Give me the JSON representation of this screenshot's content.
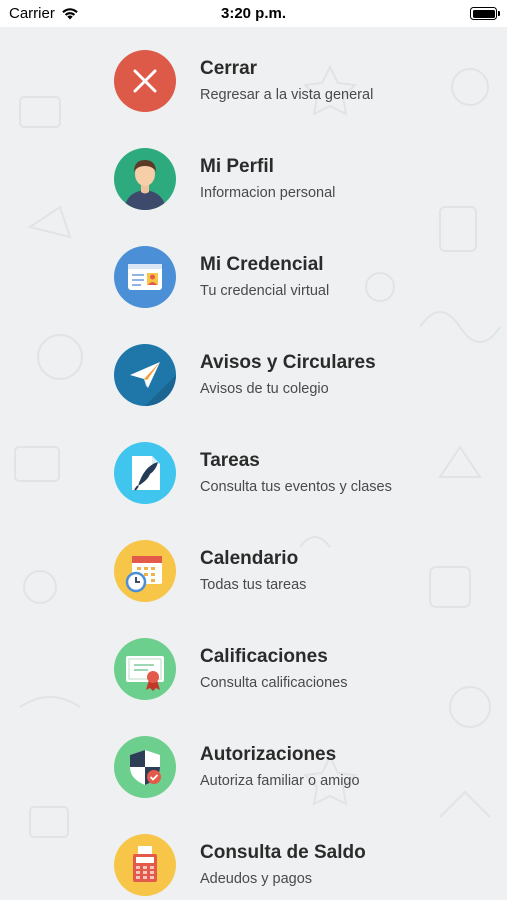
{
  "status_bar": {
    "carrier": "Carrier",
    "time": "3:20 p.m."
  },
  "menu": {
    "items": [
      {
        "title": "Cerrar",
        "subtitle": "Regresar a la vista general",
        "icon": "close-icon",
        "color": "#dc5a47"
      },
      {
        "title": "Mi Perfil",
        "subtitle": "Informacion personal",
        "icon": "user-avatar-icon",
        "color": "#2eab7e"
      },
      {
        "title": "Mi Credencial",
        "subtitle": "Tu credencial virtual",
        "icon": "id-card-icon",
        "color": "#4b8fd6"
      },
      {
        "title": "Avisos y Circulares",
        "subtitle": "Avisos de tu colegio",
        "icon": "paper-plane-icon",
        "color": "#1f77a9"
      },
      {
        "title": "Tareas",
        "subtitle": "Consulta tus eventos y clases",
        "icon": "quill-document-icon",
        "color": "#3fc5ee"
      },
      {
        "title": "Calendario",
        "subtitle": "Todas tus tareas",
        "icon": "calendar-clock-icon",
        "color": "#f7c648"
      },
      {
        "title": "Calificaciones",
        "subtitle": "Consulta calificaciones",
        "icon": "certificate-icon",
        "color": "#6dcf8e"
      },
      {
        "title": "Autorizaciones",
        "subtitle": "Autoriza familiar o amigo",
        "icon": "shield-check-icon",
        "color": "#6dcf8e"
      },
      {
        "title": "Consulta de Saldo",
        "subtitle": "Adeudos y pagos",
        "icon": "cash-register-icon",
        "color": "#f7c648"
      }
    ]
  }
}
